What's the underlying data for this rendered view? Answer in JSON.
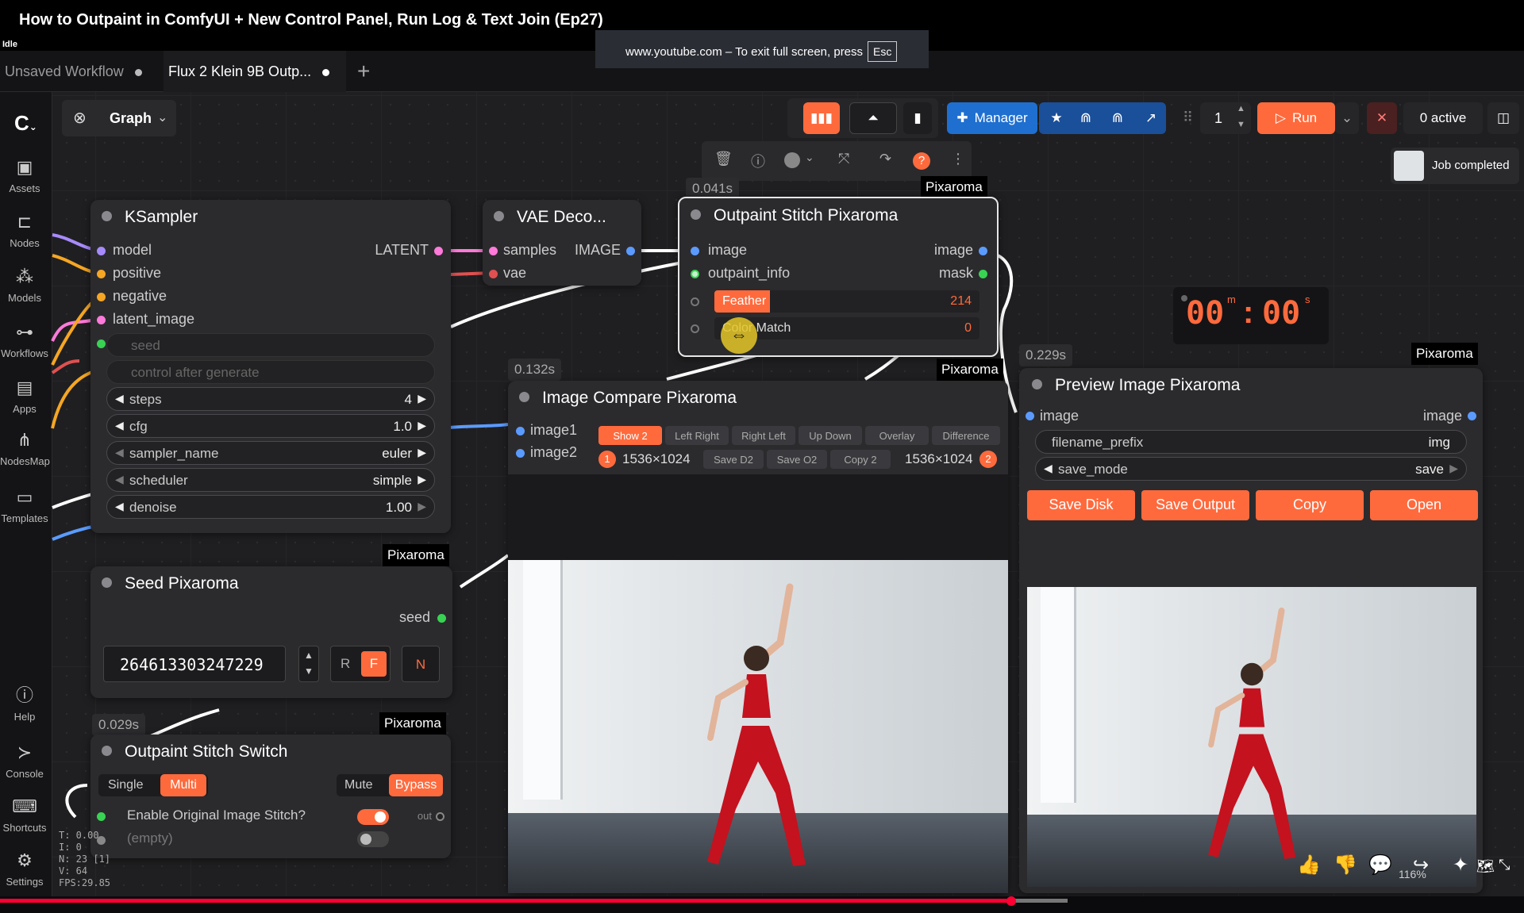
{
  "video": {
    "title": "How to Outpaint in ComfyUI + New Control Panel, Run Log & Text Join (Ep27)",
    "status": "Idle",
    "fullscreen_tip": "www.youtube.com – To exit full screen, press",
    "esc_key": "Esc"
  },
  "tabs": [
    {
      "label": "Unsaved Workflow"
    },
    {
      "label": "Flux 2 Klein 9B Outp..."
    }
  ],
  "graph_button": "Graph",
  "toolbar": {
    "manager": "Manager",
    "queue_count": "1",
    "run": "Run",
    "active": "0 active",
    "job_status": "Job completed"
  },
  "sidebar": [
    {
      "label": "Assets",
      "icon": "assets-icon"
    },
    {
      "label": "Nodes",
      "icon": "nodes-icon"
    },
    {
      "label": "Models",
      "icon": "models-icon"
    },
    {
      "label": "Workflows",
      "icon": "workflows-icon"
    },
    {
      "label": "Apps",
      "icon": "apps-icon"
    },
    {
      "label": "NodesMap",
      "icon": "nodesmap-icon"
    },
    {
      "label": "Templates",
      "icon": "templates-icon"
    },
    {
      "label": "Help",
      "icon": "help-icon"
    },
    {
      "label": "Console",
      "icon": "console-icon"
    },
    {
      "label": "Shortcuts",
      "icon": "keyboard-icon"
    },
    {
      "label": "Settings",
      "icon": "gear-icon"
    }
  ],
  "timer": {
    "minutes": "00",
    "seconds": "00",
    "m": "m",
    "s": "s"
  },
  "brand": "Pixaroma",
  "ksampler": {
    "title": "KSampler",
    "inputs": [
      "model",
      "positive",
      "negative",
      "latent_image"
    ],
    "output": "LATENT",
    "seed_label": "seed",
    "control_label": "control after generate",
    "widgets": [
      {
        "name": "steps",
        "value": "4"
      },
      {
        "name": "cfg",
        "value": "1.0"
      },
      {
        "name": "sampler_name",
        "value": "euler"
      },
      {
        "name": "scheduler",
        "value": "simple"
      },
      {
        "name": "denoise",
        "value": "1.00"
      }
    ]
  },
  "vae": {
    "title": "VAE Deco...",
    "in1": "samples",
    "in2": "vae",
    "out": "IMAGE"
  },
  "outpaint": {
    "time": "0.041s",
    "title": "Outpaint Stitch Pixaroma",
    "in1": "image",
    "in2": "outpaint_info",
    "out1": "image",
    "out2": "mask",
    "feather_label": "Feather",
    "feather_value": "214",
    "color_match_label": "Color Match",
    "color_match_value": "0"
  },
  "compare": {
    "time": "0.132s",
    "title": "Image Compare Pixaroma",
    "in1": "image1",
    "in2": "image2",
    "modes": [
      "Show 2",
      "Left Right",
      "Right Left",
      "Up Down",
      "Overlay",
      "Difference"
    ],
    "badge1": "1",
    "size1": "1536×1024",
    "actions": [
      "Save D2",
      "Save O2",
      "Copy 2"
    ],
    "size2": "1536×1024",
    "badge2": "2"
  },
  "preview": {
    "time": "0.229s",
    "title": "Preview Image Pixaroma",
    "in": "image",
    "out": "image",
    "prefix_label": "filename_prefix",
    "prefix_value": "img",
    "mode_label": "save_mode",
    "mode_value": "save",
    "buttons": [
      "Save Disk",
      "Save Output",
      "Copy",
      "Open"
    ]
  },
  "seed_node": {
    "title": "Seed Pixaroma",
    "out": "seed",
    "value": "264613303247229",
    "r": "R",
    "f": "F",
    "n": "N"
  },
  "switch": {
    "time": "0.029s",
    "title": "Outpaint Stitch Switch",
    "single": "Single",
    "multi": "Multi",
    "mute": "Mute",
    "bypass": "Bypass",
    "enable_label": "Enable Original Image Stitch?",
    "empty_label": "(empty)",
    "out": "out"
  },
  "stats": {
    "t": "T: 0.00",
    "i": "I: 0",
    "n": "N: 23 [1]",
    "v": "V: 64",
    "fps": "FPS:29.85"
  },
  "yt_controls": {
    "zoom": "116%"
  },
  "playback": {
    "progress": 0.664
  }
}
